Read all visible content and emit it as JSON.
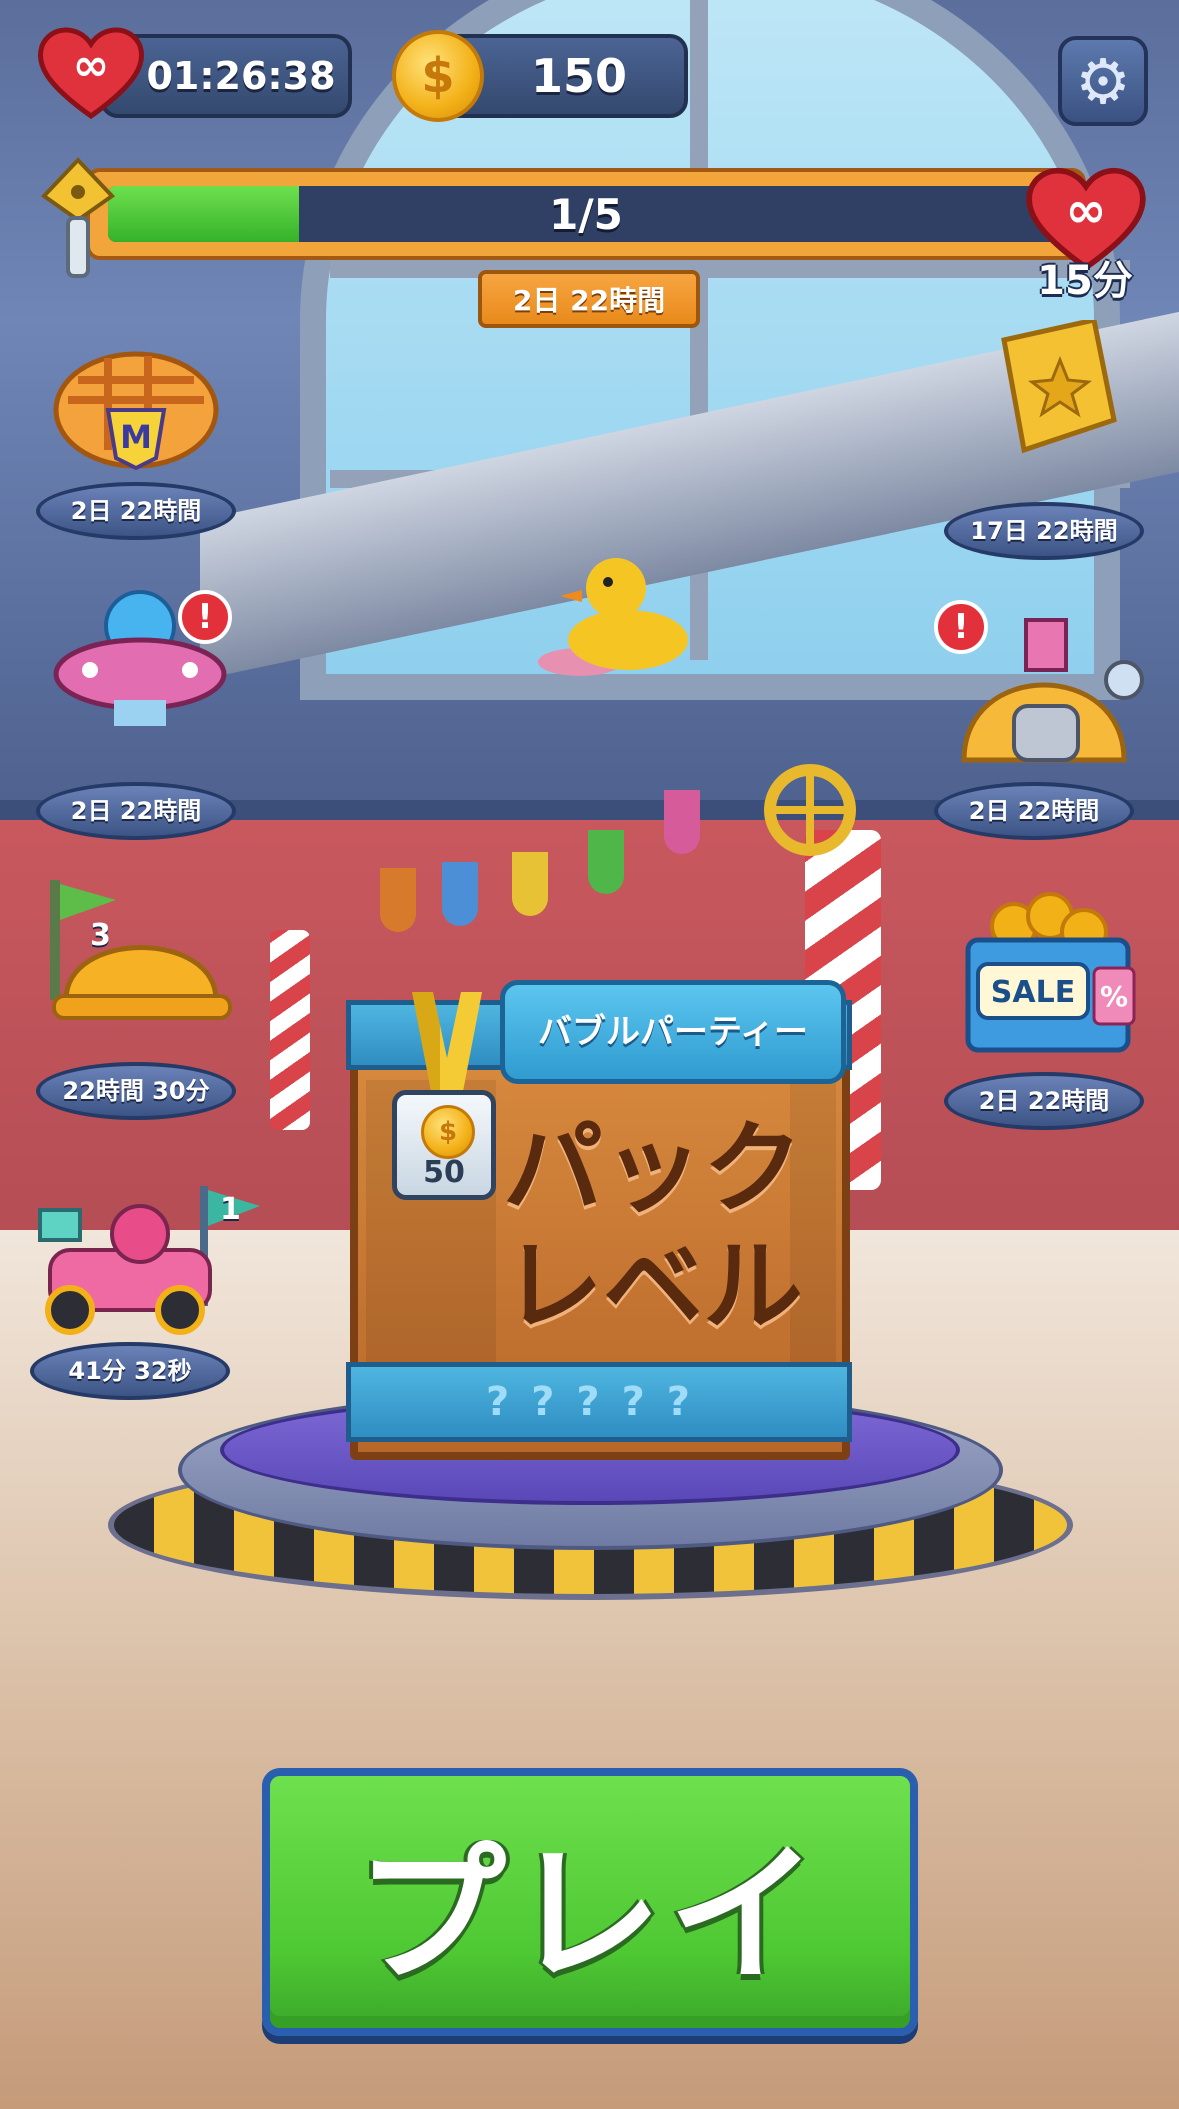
{
  "hud": {
    "lives_timer": "01:26:38",
    "coins": "150",
    "lives_icon": "infinity-heart-icon",
    "coin_icon": "coin-icon",
    "settings_icon": "gear-icon"
  },
  "progress": {
    "label": "1/5",
    "fraction": 0.2,
    "timer": "2日 22時間",
    "reward_label": "15分",
    "start_icon": "key-icon",
    "reward_icon": "infinity-heart-icon"
  },
  "events_left": [
    {
      "name": "pie-event",
      "time": "2日 22時間",
      "alert": false
    },
    {
      "name": "ufo-event",
      "time": "2日 22時間",
      "alert": true
    },
    {
      "name": "helmet-event",
      "time": "22時間 30分",
      "flag": "3"
    },
    {
      "name": "race-car-event",
      "time": "41分 32秒",
      "flag": "1"
    }
  ],
  "events_right": [
    {
      "name": "golden-ticket-event",
      "time": "17日 22時間"
    },
    {
      "name": "dome-event",
      "time": "2日 22時間",
      "alert": true
    },
    {
      "name": "sale-bag-event",
      "time": "2日 22時間",
      "sale_text": "SALE",
      "percent": "%"
    }
  ],
  "alert_symbol": "!",
  "crate": {
    "sign": "バブルパーティー",
    "title_line1": "パック",
    "title_line2": "レベル",
    "price": "50",
    "coin_symbol": "$",
    "question_marks": "?????"
  },
  "play_button": "プレイ",
  "colors": {
    "play_green": "#4ec833",
    "progress_green": "#35b22a",
    "accent_orange": "#f2a53a"
  }
}
